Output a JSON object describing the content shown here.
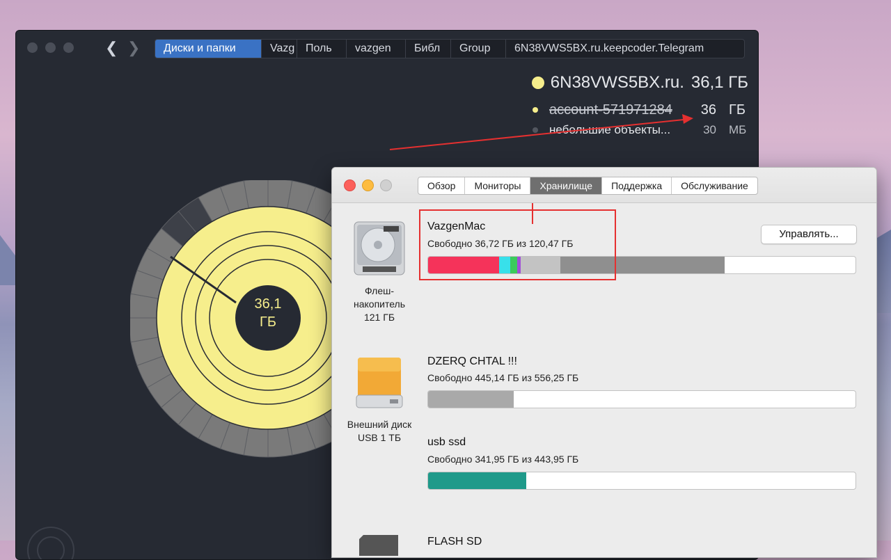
{
  "daisydisk": {
    "breadcrumbs": [
      "Диски и папки",
      "Vazg",
      "Поль",
      "vazgen",
      "Библ",
      "Group",
      "6N38VWS5BX.ru.keepcoder.Telegram"
    ],
    "selected": {
      "name": "6N38VWS5BX.ru.",
      "size": "36,1 ГБ"
    },
    "items": [
      {
        "name": "account-57197128­4",
        "value": "36",
        "unit": "ГБ"
      },
      {
        "name": "небольшие объекты...",
        "value": "30",
        "unit": "МБ"
      }
    ],
    "center_value": "36,1",
    "center_unit": "ГБ",
    "colors": {
      "folder": "#f6ee8c",
      "files": "#7a7a7a",
      "background": "#262a33"
    }
  },
  "about_mac": {
    "tabs": [
      "Обзор",
      "Мониторы",
      "Хранилище",
      "Поддержка",
      "Обслуживание"
    ],
    "active_tab": "Хранилище",
    "manage_button": "Управлять...",
    "drives": [
      {
        "name": "VazgenMac",
        "free": "Свободно 36,72 ГБ из 120,47 ГБ",
        "caption": [
          "Флеш-",
          "накопитель",
          "121 ГБ"
        ],
        "usage": [
          {
            "color": "#f5335a",
            "fraction": 0.166
          },
          {
            "color": "#38e0ea",
            "fraction": 0.026
          },
          {
            "color": "#3bcb5c",
            "fraction": 0.017
          },
          {
            "color": "#a14fd8",
            "fraction": 0.008
          },
          {
            "color": "#c3c3c3",
            "fraction": 0.092
          },
          {
            "color": "#8f8f8f",
            "fraction": 0.385
          }
        ]
      },
      {
        "name": "DZERQ CHTAL !!!",
        "free": "Свободно 445,14 ГБ из 556,25 ГБ",
        "caption": [
          "Внешний диск",
          "USB 1 ТБ"
        ],
        "usage": [
          {
            "color": "#a9a9a9",
            "fraction": 0.2
          }
        ]
      },
      {
        "name": "usb ssd",
        "free": "Свободно 341,95 ГБ из 443,95 ГБ",
        "usage": [
          {
            "color": "#1f9a8a",
            "fraction": 0.23
          }
        ]
      },
      {
        "name": "FLASH SD"
      }
    ]
  }
}
